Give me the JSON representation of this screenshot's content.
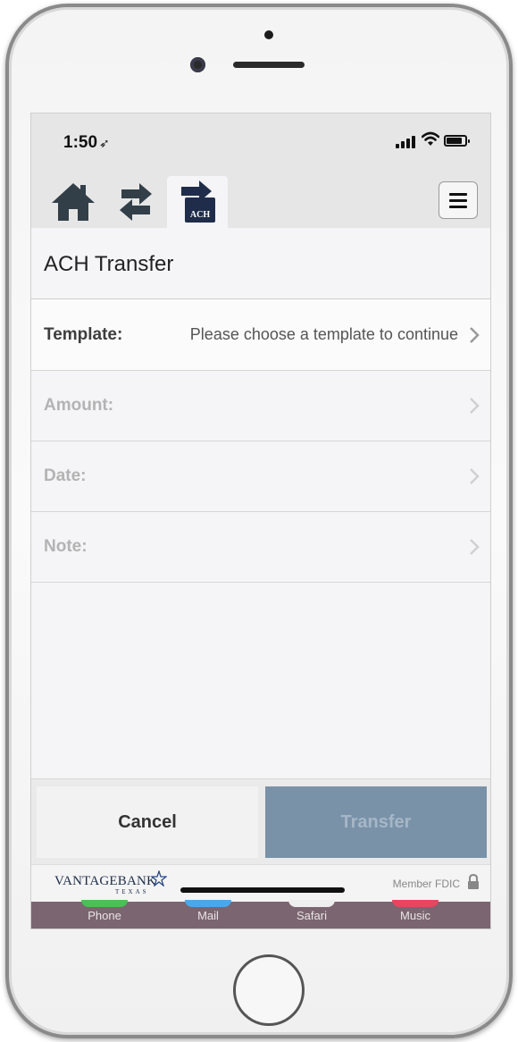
{
  "status_bar": {
    "time": "1:50",
    "time_arrow": "➶"
  },
  "toolbar": {
    "home_icon": "home-icon",
    "transfer_icon": "transfer-arrows-icon",
    "ach_icon": "ach-icon",
    "ach_badge": "ACH",
    "menu_icon": "hamburger-menu-icon"
  },
  "page": {
    "title": "ACH Transfer"
  },
  "form": {
    "template": {
      "label": "Template:",
      "value": "Please choose a template to continue"
    },
    "amount": {
      "label": "Amount:"
    },
    "date": {
      "label": "Date:"
    },
    "note": {
      "label": "Note:"
    }
  },
  "buttons": {
    "cancel": "Cancel",
    "transfer": "Transfer"
  },
  "footer": {
    "bank_name": "VANTAGEBANK",
    "bank_state": "TEXAS",
    "fdic": "Member FDIC"
  },
  "dock": {
    "phone": "Phone",
    "mail": "Mail",
    "safari": "Safari",
    "music": "Music"
  },
  "colors": {
    "brand_navy": "#1f2d4a",
    "icon_dark": "#333f48",
    "transfer_button_bg": "#7a92a8",
    "transfer_button_text": "#a5b6c7"
  }
}
